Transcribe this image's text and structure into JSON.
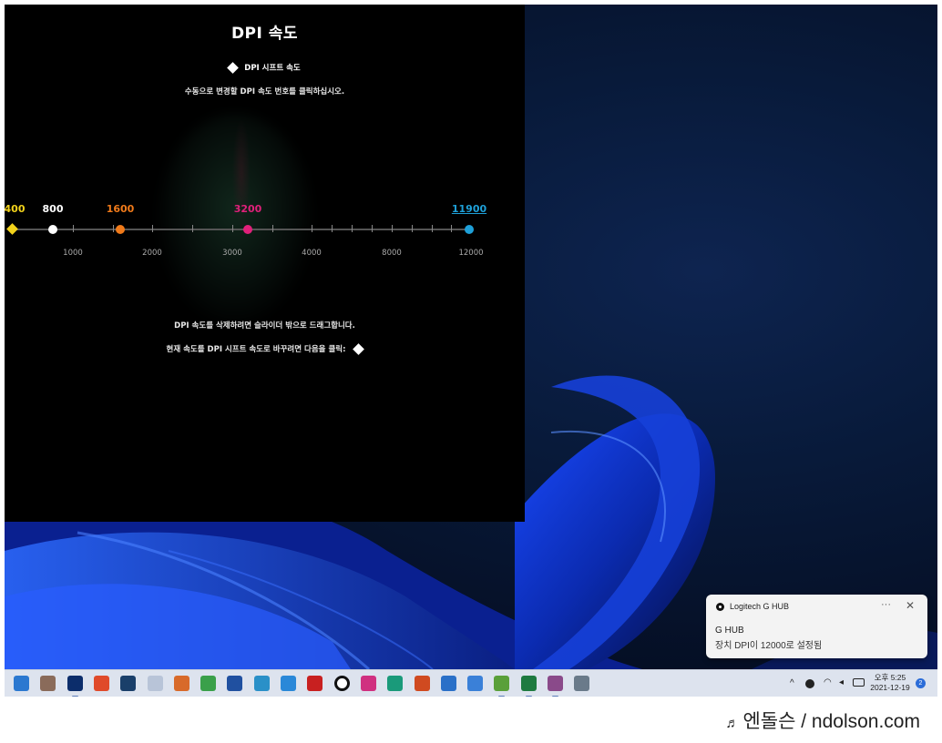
{
  "ghub": {
    "title": "DPI 속도",
    "shift_label": "DPI 시프트 속도",
    "instruction": "수동으로 변경할 DPI 속도 번호를 클릭하십시오.",
    "dpi_levels": [
      {
        "label": "400",
        "value": 400,
        "color": "#f2d21b"
      },
      {
        "label": "800",
        "value": 800,
        "color": "#ffffff"
      },
      {
        "label": "1600",
        "value": 1600,
        "color": "#f07a1a"
      },
      {
        "label": "3200",
        "value": 3200,
        "color": "#e0207a"
      },
      {
        "label": "11900",
        "value": 11900,
        "color": "#1ea0d8"
      }
    ],
    "axis_labels": [
      "1000",
      "2000",
      "3000",
      "4000",
      "8000",
      "12000"
    ],
    "hint_delete": "DPI 속도를 삭제하려면 슬라이더 밖으로 드래그합니다.",
    "hint_shift": "현재 속도를 DPI 시프트 속도로 바꾸려면 다음을 클릭:"
  },
  "toast": {
    "app_name": "Logitech G HUB",
    "more_label": "···",
    "close_label": "✕",
    "heading": "G HUB",
    "message": "장치 DPI이 12000로 설정됨"
  },
  "taskbar": {
    "apps": [
      {
        "name": "mail-icon",
        "color": "#2b78d0"
      },
      {
        "name": "photo-viewer-icon",
        "color": "#8a6b5a"
      },
      {
        "name": "photoshop-icon",
        "color": "#0c2d6b"
      },
      {
        "name": "capture-icon",
        "color": "#e04a2a"
      },
      {
        "name": "monitor-app-icon",
        "color": "#1a3f6a"
      },
      {
        "name": "notepad-icon",
        "color": "#b8c4d8"
      },
      {
        "name": "winrar-icon",
        "color": "#d86a2a"
      },
      {
        "name": "chrome-like-icon",
        "color": "#3aa04a"
      },
      {
        "name": "cloud-app-icon",
        "color": "#2050a0"
      },
      {
        "name": "camera-app-icon",
        "color": "#2a90c8"
      },
      {
        "name": "store-icon",
        "color": "#2a88d8"
      },
      {
        "name": "filezilla-icon",
        "color": "#c82020"
      },
      {
        "name": "ghub-icon",
        "color": "#111111"
      },
      {
        "name": "color-picker-icon",
        "color": "#d03080"
      },
      {
        "name": "globe-app-icon",
        "color": "#1a9a7a"
      },
      {
        "name": "powerpoint-icon",
        "color": "#d04a20"
      },
      {
        "name": "r-app-icon",
        "color": "#2a70c8"
      },
      {
        "name": "window-app-icon",
        "color": "#3a80d8"
      },
      {
        "name": "paint-icon",
        "color": "#5aa03a"
      },
      {
        "name": "excel-icon",
        "color": "#1e7a40"
      },
      {
        "name": "image-editor-icon",
        "color": "#8a4a8a"
      },
      {
        "name": "settings-icon",
        "color": "#6a7a8a"
      }
    ],
    "tray_chevron": "^",
    "clock_time": "오후 5:25",
    "clock_date": "2021-12-19",
    "notification_count": "2"
  },
  "watermark": {
    "note_glyph": "♬",
    "text": "엔돌슨 / ndolson.com"
  }
}
